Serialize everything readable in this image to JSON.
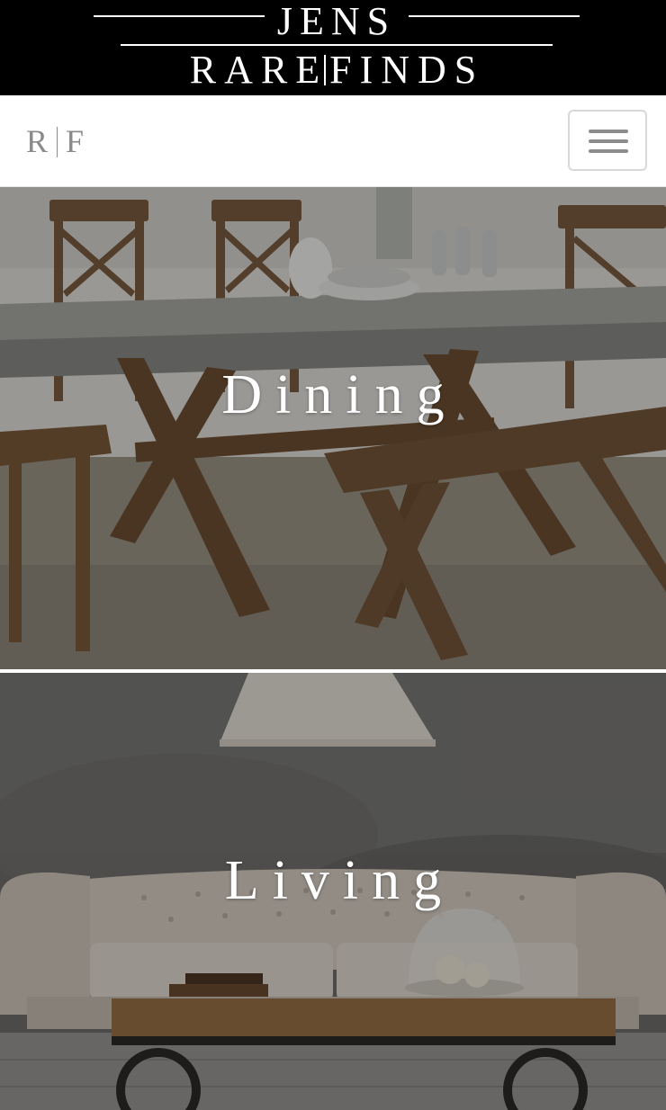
{
  "brand": {
    "line1": "JENS",
    "line2_left": "RARE",
    "line2_right": "FINDS"
  },
  "nav": {
    "logo_left": "R",
    "logo_right": "F",
    "menu_icon": "hamburger-icon"
  },
  "categories": [
    {
      "label": "Dining"
    },
    {
      "label": "Living"
    }
  ],
  "colors": {
    "header_bg": "#000000",
    "header_text": "#ffffff",
    "nav_logo": "#8a8a8a",
    "toggle_border": "#d8d8d8",
    "overlay": "rgba(0,0,0,0.32)"
  }
}
